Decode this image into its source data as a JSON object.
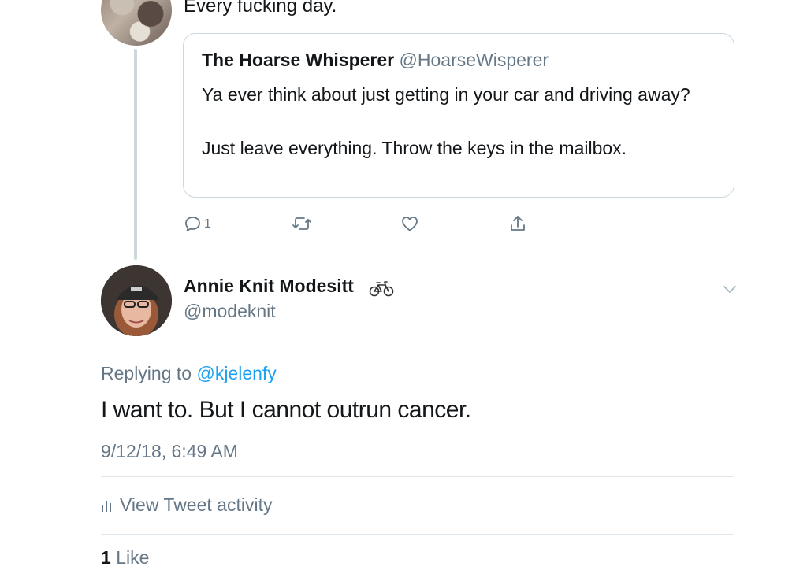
{
  "parent_tweet": {
    "text": "Every fucking day."
  },
  "quoted_tweet": {
    "name": "The Hoarse Whisperer",
    "handle": "@HoarseWisperer",
    "body_line1": "Ya ever think about just getting in your car and driving away?",
    "body_line2": "Just leave everything. Throw the keys in the mailbox."
  },
  "parent_actions": {
    "reply_count": "1",
    "icons": [
      "reply-icon",
      "retweet-icon",
      "like-icon",
      "share-icon"
    ]
  },
  "main_tweet": {
    "author_name": "Annie Knit Modesitt",
    "author_emoji": "bicycle-icon",
    "author_handle": "@modeknit",
    "replying_prefix": "Replying to ",
    "replying_to": "@kjelenfy",
    "text": "I want to. But I cannot outrun cancer.",
    "timestamp": "9/12/18, 6:49 AM",
    "activity_label": "View Tweet activity",
    "like_count": "1",
    "like_label": "Like"
  },
  "colors": {
    "text_primary": "#14171a",
    "text_secondary": "#657786",
    "link": "#1da1f2",
    "border": "#ccd6dd",
    "divider": "#e1e8ed"
  }
}
